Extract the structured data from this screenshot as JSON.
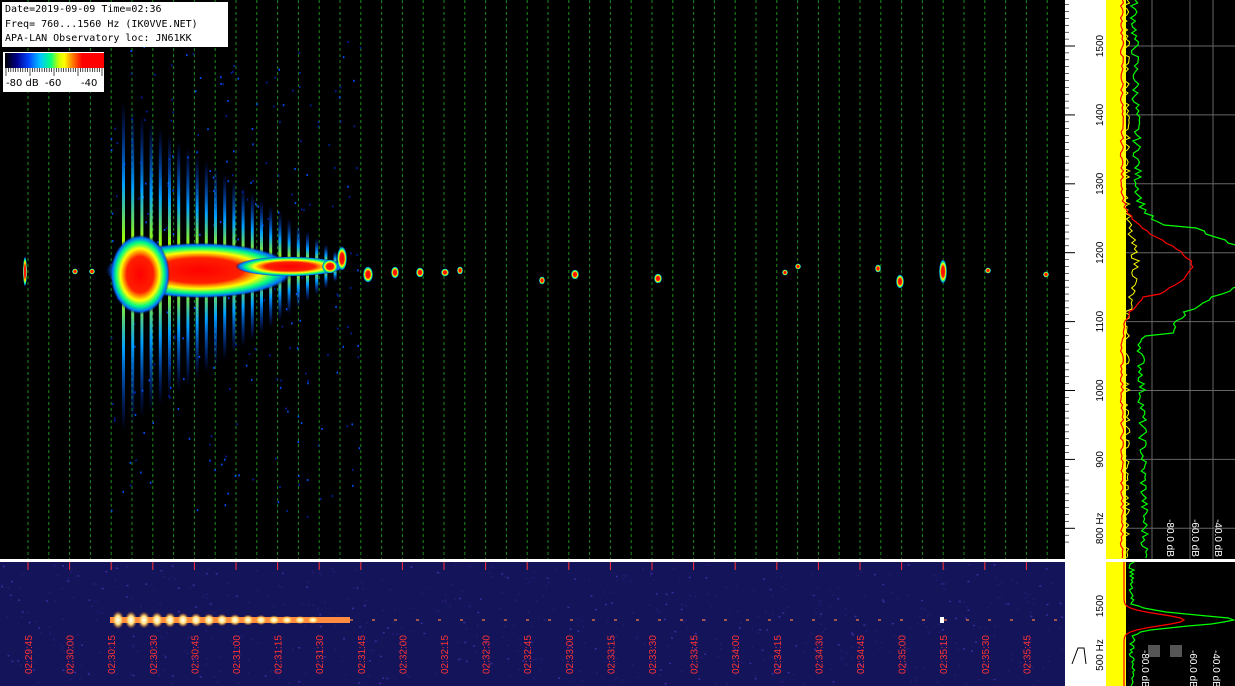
{
  "header": {
    "line1": "Date=2019-09-09 Time=02:36",
    "line2": "Freq= 760...1560 Hz (IK0VVE.NET)",
    "line3": "APA-LAN Observatory loc: JN61KK"
  },
  "color_scale": {
    "labels": [
      "-80 dB",
      "-60",
      "-40"
    ]
  },
  "chart_data": [
    {
      "type": "heatmap",
      "name_hint": "main-spectrogram",
      "xlabel": "",
      "ylabel": "",
      "y_unit": "Hz",
      "y_ticks": [
        800,
        900,
        1000,
        1100,
        1200,
        1300,
        1400,
        1500
      ],
      "y_tick_labels": [
        "800 Hz",
        "900",
        "1000",
        "1100",
        "1200",
        "1300",
        "1400",
        "1500"
      ],
      "ylim": [
        760,
        1560
      ],
      "color_scale_db": [
        -80,
        -40
      ],
      "signal_center_hz": 1180,
      "bursts": [
        {
          "time": "02:30:15",
          "intensity": "high"
        },
        {
          "time": "02:30:30",
          "intensity": "high"
        },
        {
          "time": "02:30:45",
          "intensity": "high"
        },
        {
          "time": "02:31:00",
          "intensity": "high"
        },
        {
          "time": "02:31:15",
          "intensity": "medium"
        },
        {
          "time": "02:31:30",
          "intensity": "medium"
        },
        {
          "time": "02:31:45",
          "intensity": "low"
        },
        {
          "time": "02:33:00",
          "intensity": "low"
        },
        {
          "time": "02:33:30",
          "intensity": "low"
        },
        {
          "time": "02:34:30",
          "intensity": "low"
        },
        {
          "time": "02:35:00",
          "intensity": "low"
        },
        {
          "time": "02:35:15",
          "intensity": "medium"
        }
      ],
      "colors": {
        "background": "#000000",
        "grid": "#1f8a1f",
        "signal": "#ff0000"
      }
    },
    {
      "type": "heatmap",
      "name_hint": "overview-spectrogram",
      "y_ticks": [
        500,
        1500
      ],
      "y_tick_labels": [
        "500 Hz",
        "1500"
      ],
      "x_tick_labels": [
        "02:29:45",
        "02:30:00",
        "02:30:15",
        "02:30:30",
        "02:30:45",
        "02:31:00",
        "02:31:15",
        "02:31:30",
        "02:31:45",
        "02:32:00",
        "02:32:15",
        "02:32:30",
        "02:32:45",
        "02:33:00",
        "02:33:15",
        "02:33:30",
        "02:33:45",
        "02:34:00",
        "02:34:15",
        "02:34:30",
        "02:34:45",
        "02:35:00",
        "02:35:15",
        "02:35:30",
        "02:35:45"
      ],
      "colors": {
        "background": "#1a1a66",
        "tick_label": "#ff3333"
      }
    },
    {
      "type": "line",
      "name_hint": "spectrum-profile",
      "x_tick_labels": [
        "-80.0 dB",
        "-60.0 dB",
        "-40.0 dB"
      ],
      "y_ticks": [
        800,
        900,
        1000,
        1100,
        1200,
        1300,
        1400,
        1500
      ],
      "series_colors": {
        "max_hold": "#ffff00",
        "average": "#ff0000",
        "peak": "#00ff00"
      }
    },
    {
      "type": "line",
      "name_hint": "overview-profile",
      "x_tick_labels": [
        "-80.0 dB",
        "-60.0 dB",
        "-40.0 dB"
      ],
      "y_tick_labels": [
        "500 Hz",
        "1500"
      ]
    }
  ]
}
